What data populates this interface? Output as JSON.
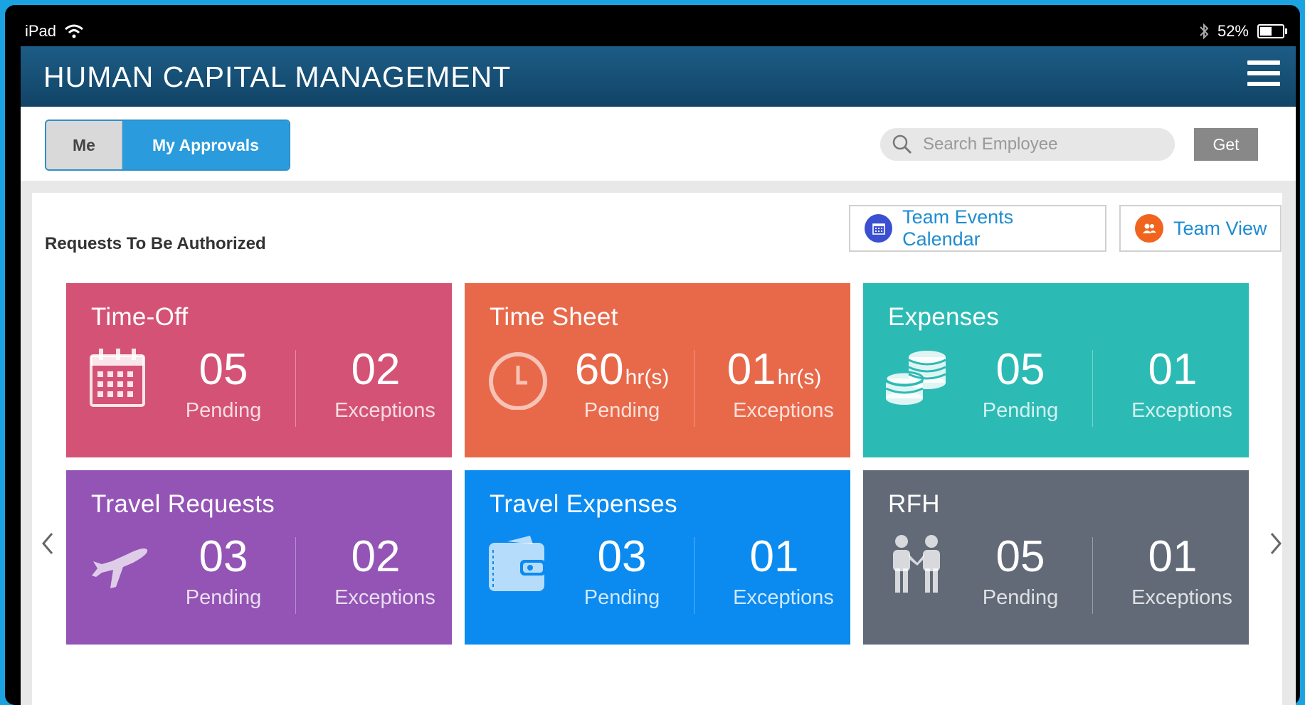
{
  "status_bar": {
    "device": "iPad",
    "battery": "52%",
    "battery_level": 0.52
  },
  "app": {
    "title": "HUMAN CAPITAL MANAGEMENT"
  },
  "segment": {
    "me": "Me",
    "approvals": "My Approvals",
    "active": "My Approvals"
  },
  "search": {
    "placeholder": "Search Employee",
    "button": "Get"
  },
  "main": {
    "section_title": "Requests To Be Authorized",
    "team_events_calendar": "Team Events Calendar",
    "team_view": "Team View"
  },
  "tiles": [
    {
      "title": "Time-Off",
      "pending": "05",
      "exceptions": "02",
      "pending_label": "Pending",
      "exceptions_label": "Exceptions",
      "icon": "calendar-icon",
      "color": "#d45275"
    },
    {
      "title": "Time Sheet",
      "pending": "60",
      "pending_unit": "hr(s)",
      "exceptions": "01",
      "exceptions_unit": "hr(s)",
      "pending_label": "Pending",
      "exceptions_label": "Exceptions",
      "icon": "clock-icon",
      "color": "#e8694a"
    },
    {
      "title": "Expenses",
      "pending": "05",
      "exceptions": "01",
      "pending_label": "Pending",
      "exceptions_label": "Exceptions",
      "icon": "coins-icon",
      "color": "#2cbbb4"
    },
    {
      "title": "Travel Requests",
      "pending": "03",
      "exceptions": "02",
      "pending_label": "Pending",
      "exceptions_label": "Exceptions",
      "icon": "airplane-icon",
      "color": "#9354b5"
    },
    {
      "title": "Travel Expenses",
      "pending": "03",
      "exceptions": "01",
      "pending_label": "Pending",
      "exceptions_label": "Exceptions",
      "icon": "wallet-icon",
      "color": "#0b8af0"
    },
    {
      "title": "RFH",
      "pending": "05",
      "exceptions": "01",
      "pending_label": "Pending",
      "exceptions_label": "Exceptions",
      "icon": "people-icon",
      "color": "#626a77"
    }
  ]
}
